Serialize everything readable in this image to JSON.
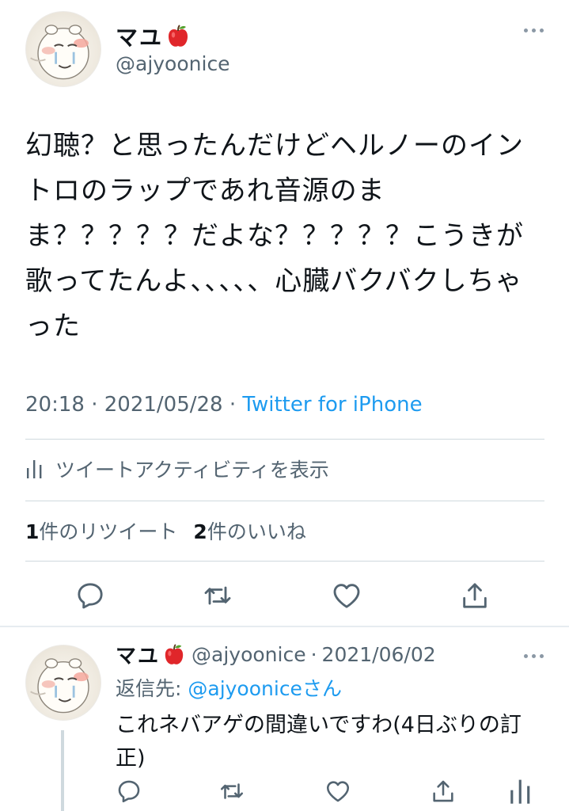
{
  "tweet": {
    "author": {
      "display_name": "マユ",
      "emoji": "apple-icon",
      "handle": "@ajyoonice"
    },
    "text": "幻聴？と思ったんだけどヘルノーのイントロのラップであれ音源のまま？？？？？だよな？？？？？こうきが歌ってたんよ、、、、、心臓バクバクしちゃった",
    "time": "20:18",
    "date": "2021/05/28",
    "separator": "·",
    "source": "Twitter for iPhone",
    "activity_label": "ツイートアクティビティを表示",
    "retweet_count": "1",
    "retweet_label": "件のリツイート",
    "like_count": "2",
    "like_label": "件のいいね"
  },
  "reply": {
    "author": {
      "display_name": "マユ",
      "handle": "@ajyoonice"
    },
    "separator": "·",
    "date": "2021/06/02",
    "reply_to_prefix": "返信先: ",
    "reply_to_handle": "@ajyoonice",
    "reply_to_suffix": "さん",
    "text": "これネバアゲの間違いですわ(4日ぶりの訂正)"
  },
  "colors": {
    "text": "#0f1419",
    "secondary": "#536471",
    "accent": "#1d9bf0",
    "divider": "#cfd9de"
  },
  "icons": [
    "more-icon",
    "apple-icon",
    "activity-icon",
    "reply-icon",
    "retweet-icon",
    "like-icon",
    "share-icon"
  ]
}
